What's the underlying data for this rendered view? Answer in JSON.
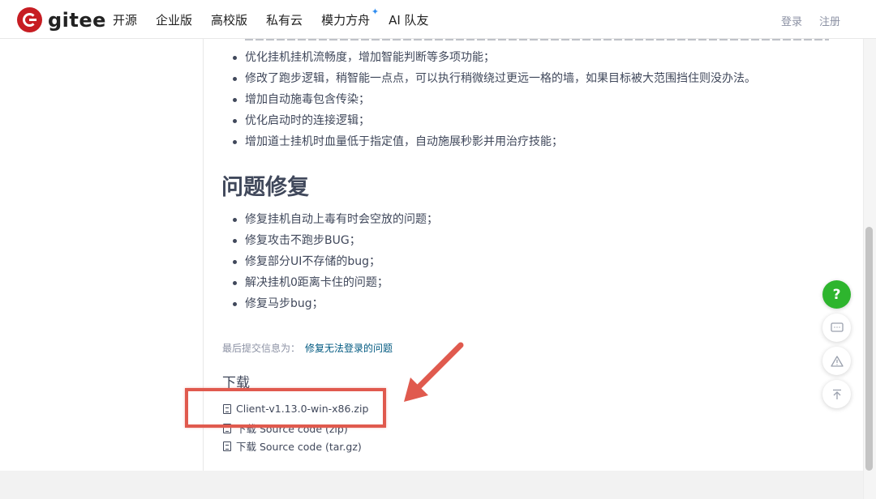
{
  "header": {
    "logo_text": "gitee",
    "nav": [
      "开源",
      "企业版",
      "高校版",
      "私有云",
      "模力方舟",
      "AI 队友"
    ],
    "sparkle": "✦",
    "login": "登录",
    "register": "注册"
  },
  "features_list": [
    "优化挂机挂机流畅度，增加智能判断等多项功能；",
    "修改了跑步逻辑，稍智能一点点，可以执行稍微绕过更远一格的墙，如果目标被大范围挡住则没办法。",
    "增加自动施毒包含传染；",
    "优化启动时的连接逻辑；",
    "增加道士挂机时血量低于指定值，自动施展秒影并用治疗技能；"
  ],
  "bugfix_title": "问题修复",
  "bugfix_list": [
    "修复挂机自动上毒有时会空放的问题；",
    "修复攻击不跑步BUG；",
    "修复部分UI不存储的bug；",
    "解决挂机0距离卡住的问题；",
    "修复马步bug；"
  ],
  "commit": {
    "label": "最后提交信息为：",
    "message": "修复无法登录的问题"
  },
  "downloads": {
    "title": "下载",
    "items": [
      "Client-v1.13.0-win-x86.zip",
      "下载 Source code (zip)",
      "下载 Source code (tar.gz)"
    ]
  },
  "floating": {
    "help": "?",
    "icons": [
      "comment-icon",
      "warning-icon",
      "back-to-top-icon"
    ]
  },
  "colors": {
    "highlight": "#e05a4e",
    "help_button": "#2eb52e",
    "link": "#005980",
    "brand": "#c71d23"
  }
}
